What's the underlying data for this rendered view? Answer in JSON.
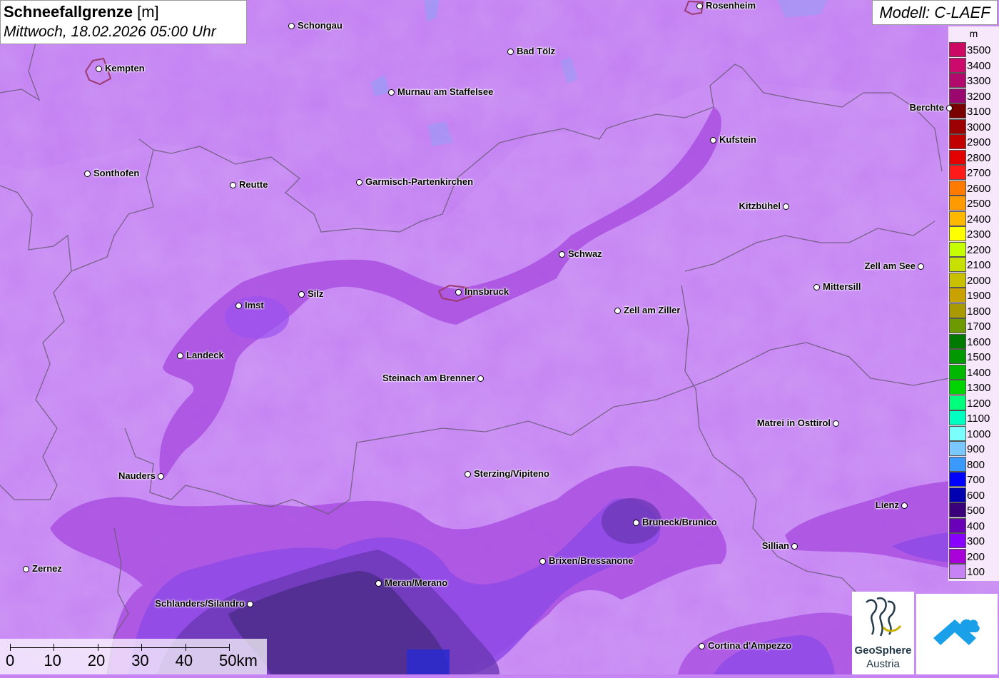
{
  "header": {
    "title_bold": "Schneefallgrenze",
    "title_unit": "[m]",
    "datetime": "Mittwoch, 18.02.2026 05:00 Uhr"
  },
  "model": {
    "label": "Modell: C-LAEF"
  },
  "legend": {
    "unit": "m",
    "items": [
      {
        "label": "3500",
        "color": "#cc0a63"
      },
      {
        "label": "3400",
        "color": "#cc0a6c"
      },
      {
        "label": "3300",
        "color": "#b10a6c"
      },
      {
        "label": "3200",
        "color": "#9a076f"
      },
      {
        "label": "3100",
        "color": "#7a0000"
      },
      {
        "label": "3000",
        "color": "#9c0000"
      },
      {
        "label": "2900",
        "color": "#c20000"
      },
      {
        "label": "2800",
        "color": "#e30000"
      },
      {
        "label": "2700",
        "color": "#ff1a1a"
      },
      {
        "label": "2600",
        "color": "#ff7a00"
      },
      {
        "label": "2500",
        "color": "#ff9a00"
      },
      {
        "label": "2400",
        "color": "#ffb800"
      },
      {
        "label": "2300",
        "color": "#ffff00"
      },
      {
        "label": "2200",
        "color": "#c6ff00"
      },
      {
        "label": "2100",
        "color": "#c8e000"
      },
      {
        "label": "2000",
        "color": "#c8c000"
      },
      {
        "label": "1900",
        "color": "#c9a200"
      },
      {
        "label": "1800",
        "color": "#a89a00"
      },
      {
        "label": "1700",
        "color": "#6c9a00"
      },
      {
        "label": "1600",
        "color": "#007a00"
      },
      {
        "label": "1500",
        "color": "#009a00"
      },
      {
        "label": "1400",
        "color": "#00b800"
      },
      {
        "label": "1300",
        "color": "#00d400"
      },
      {
        "label": "1200",
        "color": "#00ff7a"
      },
      {
        "label": "1100",
        "color": "#00ffc0"
      },
      {
        "label": "1000",
        "color": "#7affff"
      },
      {
        "label": "900",
        "color": "#7ac8ff"
      },
      {
        "label": "800",
        "color": "#3a9aff"
      },
      {
        "label": "700",
        "color": "#0000ff"
      },
      {
        "label": "600",
        "color": "#0000b0"
      },
      {
        "label": "500",
        "color": "#3a007a"
      },
      {
        "label": "400",
        "color": "#6a00b8"
      },
      {
        "label": "300",
        "color": "#8a00ff"
      },
      {
        "label": "200",
        "color": "#a800d8"
      },
      {
        "label": "100",
        "color": "#c583f3"
      }
    ]
  },
  "cities": [
    {
      "name": "Rosenheim",
      "side": "right"
    },
    {
      "name": "Schongau",
      "side": "right"
    },
    {
      "name": "Kempten",
      "side": "right"
    },
    {
      "name": "Bad Tölz",
      "side": "right"
    },
    {
      "name": "Murnau am Staffelsee",
      "side": "right"
    },
    {
      "name": "Berchte",
      "side": "left"
    },
    {
      "name": "Kufstein",
      "side": "right"
    },
    {
      "name": "Sonthofen",
      "side": "right"
    },
    {
      "name": "Reutte",
      "side": "right"
    },
    {
      "name": "Garmisch-Partenkirchen",
      "side": "right"
    },
    {
      "name": "Kitzbühel",
      "side": "left"
    },
    {
      "name": "Schwaz",
      "side": "right"
    },
    {
      "name": "Zell am See",
      "side": "left"
    },
    {
      "name": "Imst",
      "side": "right"
    },
    {
      "name": "Silz",
      "side": "right"
    },
    {
      "name": "Innsbruck",
      "side": "right"
    },
    {
      "name": "Mittersill",
      "side": "right"
    },
    {
      "name": "Zell am Ziller",
      "side": "right"
    },
    {
      "name": "Landeck",
      "side": "right"
    },
    {
      "name": "Steinach am Brenner",
      "side": "left"
    },
    {
      "name": "Matrei in Osttirol",
      "side": "left"
    },
    {
      "name": "Nauders",
      "side": "left"
    },
    {
      "name": "Sterzing/Vipiteno",
      "side": "right"
    },
    {
      "name": "Lienz",
      "side": "left"
    },
    {
      "name": "Bruneck/Brunico",
      "side": "right"
    },
    {
      "name": "Sillian",
      "side": "left"
    },
    {
      "name": "Brixen/Bressanone",
      "side": "right"
    },
    {
      "name": "Zernez",
      "side": "right"
    },
    {
      "name": "Meran/Merano",
      "side": "right"
    },
    {
      "name": "Schlanders/Silandro",
      "side": "left"
    },
    {
      "name": "Cortina d'Ampezzo",
      "side": "right"
    }
  ],
  "scale": {
    "labels": [
      "0",
      "10",
      "20",
      "30",
      "40",
      "50km"
    ]
  },
  "logos": {
    "geosphere_line1": "GeoSphere",
    "geosphere_line2": "Austria",
    "geosphere_icon": "geosphere-logo-icon",
    "app_icon": "cloud-arrow-icon"
  }
}
